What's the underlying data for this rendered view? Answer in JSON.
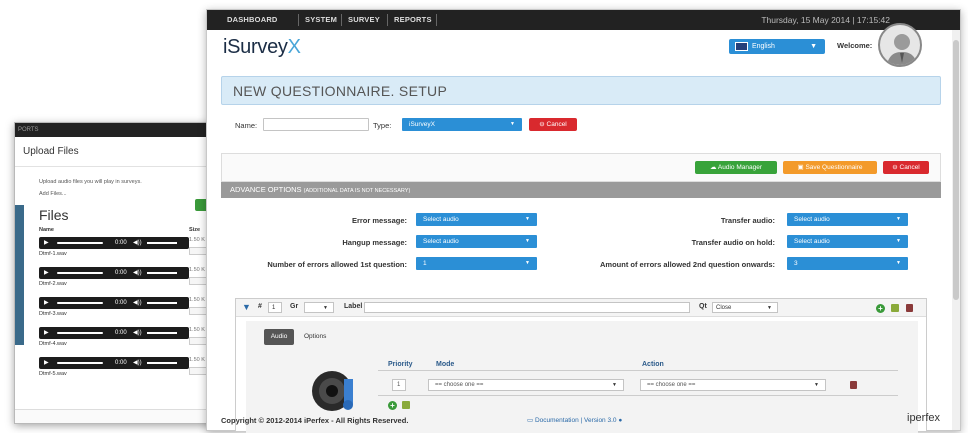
{
  "upload_window": {
    "topbar_text": "PORTS",
    "title": "Upload Files",
    "description": "Upload audio files you will play in surveys.",
    "add_files": "Add Files...",
    "files_heading": "Files",
    "col_name": "Name",
    "col_size": "Size",
    "files": [
      {
        "name": "Dtmf-1.wav",
        "size": "1.50 K",
        "time": "0:00"
      },
      {
        "name": "Dtmf-2.wav",
        "size": "1.50 K",
        "time": "0:00"
      },
      {
        "name": "Dtmf-3.wav",
        "size": "1.50 K",
        "time": "0:00"
      },
      {
        "name": "Dtmf-4.wav",
        "size": "1.50 K",
        "time": "0:00"
      },
      {
        "name": "Dtmf-5.wav",
        "size": "1.50 K",
        "time": "0:00"
      }
    ]
  },
  "nav": {
    "items": [
      "DASHBOARD",
      "SYSTEM",
      "SURVEY",
      "REPORTS"
    ],
    "datetime": "Thursday, 15 May 2014 | 17:15:42"
  },
  "header": {
    "logo_main": "iSurvey",
    "logo_x": "X",
    "language": "English",
    "welcome": "Welcome:"
  },
  "page": {
    "title": "NEW QUESTIONNAIRE. SETUP"
  },
  "setup_form": {
    "name_label": "Name:",
    "name_value": "",
    "type_label": "Type:",
    "type_value": "iSurveyX",
    "cancel_label": "Cancel"
  },
  "toolbar": {
    "audio_manager": "Audio Manager",
    "save_questionnaire": "Save Questionnaire",
    "cancel": "Cancel"
  },
  "advance": {
    "title": "ADVANCE OPTIONS",
    "subtitle": "(ADDITIONAL DATA IS NOT NECESSARY)",
    "error_message_label": "Error message:",
    "error_message_value": "Select audio",
    "hangup_message_label": "Hangup message:",
    "hangup_message_value": "Select audio",
    "errors_first_label": "Number of errors allowed 1st question:",
    "errors_first_value": "1",
    "transfer_audio_label": "Transfer audio:",
    "transfer_audio_value": "Select audio",
    "transfer_hold_label": "Transfer audio on hold:",
    "transfer_hold_value": "Select audio",
    "errors_second_label": "Amount of errors allowed 2nd question onwards:",
    "errors_second_value": "3"
  },
  "question": {
    "hash": "#",
    "number": "1",
    "gr_label": "Gr",
    "label_label": "Label",
    "label_value": "",
    "qt_label": "Qt",
    "qt_value": "Close",
    "tab_audio": "Audio",
    "tab_options": "Options",
    "col_priority": "Priority",
    "col_mode": "Mode",
    "col_action": "Action",
    "priority_value": "1",
    "mode_value": "== choose one ==",
    "action_value": "== choose one =="
  },
  "footer": {
    "copyright": "Copyright © 2012-2014 iPerfex - All Rights Reserved.",
    "documentation": "Documentation | Version 3.0",
    "brand": "iperfex"
  }
}
